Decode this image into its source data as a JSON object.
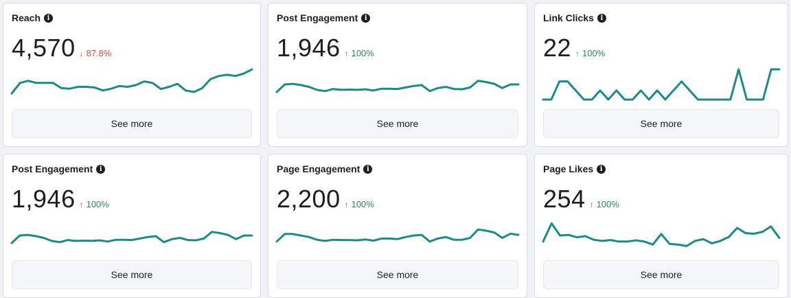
{
  "accent_color": "#1a8a8a",
  "cards": [
    {
      "title": "Reach",
      "value": "4,570",
      "change": "87.8%",
      "direction": "down",
      "arrow": "↓",
      "button": "See more",
      "sparkline": [
        0.2,
        0.55,
        0.62,
        0.55,
        0.55,
        0.55,
        0.38,
        0.36,
        0.42,
        0.42,
        0.4,
        0.3,
        0.36,
        0.45,
        0.42,
        0.48,
        0.6,
        0.55,
        0.35,
        0.42,
        0.52,
        0.3,
        0.25,
        0.38,
        0.68,
        0.78,
        0.82,
        0.78,
        0.86,
        1.0
      ]
    },
    {
      "title": "Post Engagement",
      "value": "1,946",
      "change": "100%",
      "direction": "up",
      "arrow": "↑",
      "button": "See more",
      "sparkline": [
        0.25,
        0.5,
        0.52,
        0.48,
        0.42,
        0.32,
        0.28,
        0.35,
        0.32,
        0.33,
        0.32,
        0.34,
        0.3,
        0.36,
        0.36,
        0.35,
        0.4,
        0.45,
        0.48,
        0.28,
        0.38,
        0.42,
        0.35,
        0.34,
        0.4,
        0.62,
        0.58,
        0.52,
        0.38,
        0.5,
        0.5
      ]
    },
    {
      "title": "Link Clicks",
      "value": "22",
      "change": "100%",
      "direction": "up",
      "arrow": "↑",
      "button": "See more",
      "sparkline": [
        0,
        0,
        0.6,
        0.6,
        0.3,
        0,
        0,
        0.3,
        0,
        0.3,
        0,
        0,
        0.3,
        0,
        0.3,
        0,
        0.3,
        0.6,
        0.3,
        0,
        0,
        0,
        0,
        0,
        1.0,
        0,
        0,
        0,
        1.0,
        1.0
      ]
    },
    {
      "title": "Post Engagement",
      "value": "1,946",
      "change": "100%",
      "direction": "up",
      "arrow": "↑",
      "button": "See more",
      "sparkline": [
        0.25,
        0.5,
        0.52,
        0.48,
        0.42,
        0.32,
        0.28,
        0.35,
        0.32,
        0.33,
        0.32,
        0.34,
        0.3,
        0.36,
        0.36,
        0.35,
        0.4,
        0.45,
        0.48,
        0.28,
        0.38,
        0.42,
        0.35,
        0.34,
        0.4,
        0.62,
        0.58,
        0.52,
        0.38,
        0.5,
        0.5
      ]
    },
    {
      "title": "Page Engagement",
      "value": "2,200",
      "change": "100%",
      "direction": "up",
      "arrow": "↑",
      "button": "See more",
      "sparkline": [
        0.3,
        0.55,
        0.55,
        0.5,
        0.45,
        0.36,
        0.32,
        0.36,
        0.35,
        0.35,
        0.34,
        0.37,
        0.33,
        0.4,
        0.4,
        0.38,
        0.45,
        0.5,
        0.52,
        0.3,
        0.4,
        0.45,
        0.36,
        0.36,
        0.42,
        0.7,
        0.66,
        0.6,
        0.42,
        0.56,
        0.52
      ]
    },
    {
      "title": "Page Likes",
      "value": "254",
      "change": "100%",
      "direction": "up",
      "arrow": "↑",
      "button": "See more",
      "sparkline": [
        0.3,
        0.9,
        0.5,
        0.52,
        0.44,
        0.48,
        0.36,
        0.32,
        0.35,
        0.3,
        0.3,
        0.34,
        0.3,
        0.2,
        0.55,
        0.22,
        0.2,
        0.15,
        0.32,
        0.38,
        0.24,
        0.32,
        0.45,
        0.75,
        0.58,
        0.56,
        0.62,
        0.8,
        0.42
      ]
    }
  ]
}
